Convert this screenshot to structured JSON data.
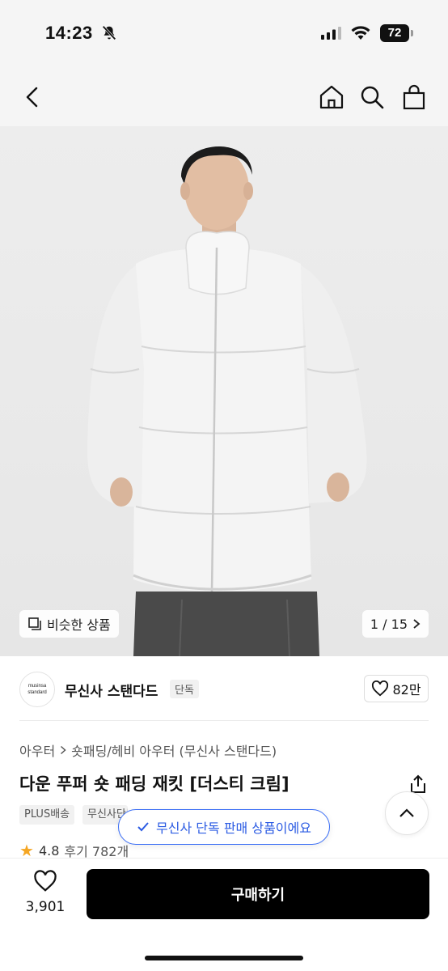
{
  "status_bar": {
    "time": "14:23",
    "battery": "72",
    "icons": [
      "bell-off-icon",
      "signal-icon",
      "wifi-icon",
      "battery-icon"
    ]
  },
  "header": {
    "icons": [
      "back-icon",
      "home-icon",
      "search-icon",
      "shopping-bag-icon"
    ]
  },
  "hero": {
    "similar_label": "비슷한 상품",
    "counter": "1 / 15"
  },
  "brand": {
    "logo_line1": "musinsa",
    "logo_line2": "standard",
    "name": "무신사 스탠다드",
    "badge": "단독",
    "likes": "82만"
  },
  "product": {
    "breadcrumb": [
      "아우터",
      "숏패딩/헤비 아우터 (무신사 스탠다드)"
    ],
    "title": "다운 푸퍼 숏 패딩 재킷 [더스티 크림]",
    "tags": [
      "PLUS배송",
      "무신사단독"
    ],
    "rating": "4.8",
    "reviews": "후기 782개"
  },
  "toast": {
    "text": "무신사 단독 판매 상품이에요"
  },
  "bottom": {
    "like_count": "3,901",
    "buy_label": "구매하기"
  },
  "colors": {
    "accent_blue": "#2b5be3",
    "buy_button": "#000000",
    "star": "#f5a623"
  }
}
